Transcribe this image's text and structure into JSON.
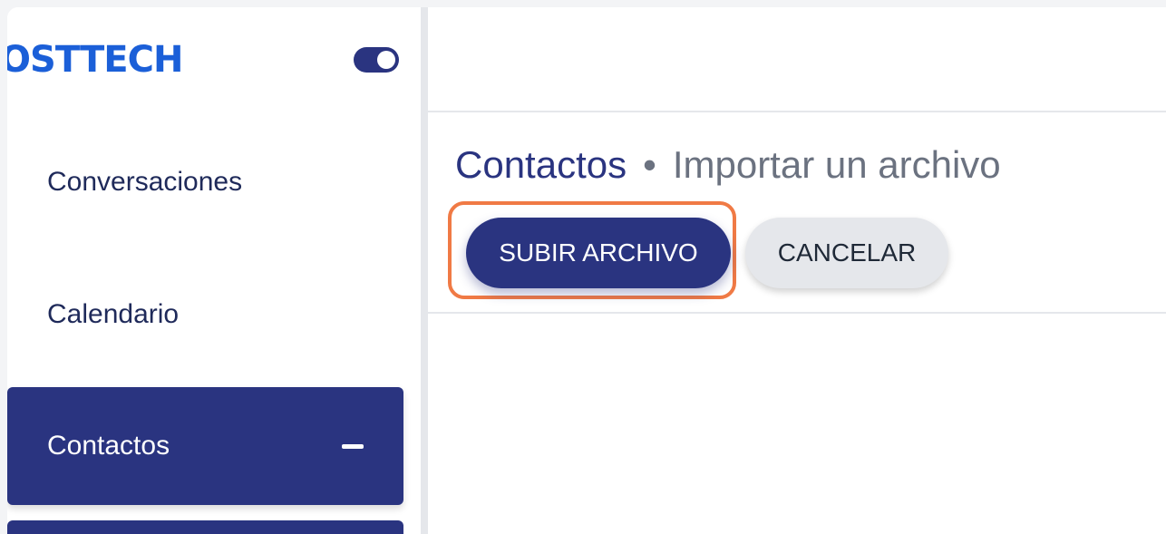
{
  "sidebar": {
    "logo_text": "OSTTECH",
    "items": [
      {
        "label": "Conversaciones"
      },
      {
        "label": "Calendario"
      },
      {
        "label": "Contactos"
      }
    ]
  },
  "main": {
    "breadcrumb": {
      "root": "Contactos",
      "separator": "•",
      "current": "Importar un archivo"
    },
    "actions": {
      "upload_label": "SUBIR ARCHIVO",
      "cancel_label": "CANCELAR"
    }
  },
  "colors": {
    "brand": "#2a3480",
    "logo": "#1b5fd8",
    "highlight": "#f07a45"
  }
}
